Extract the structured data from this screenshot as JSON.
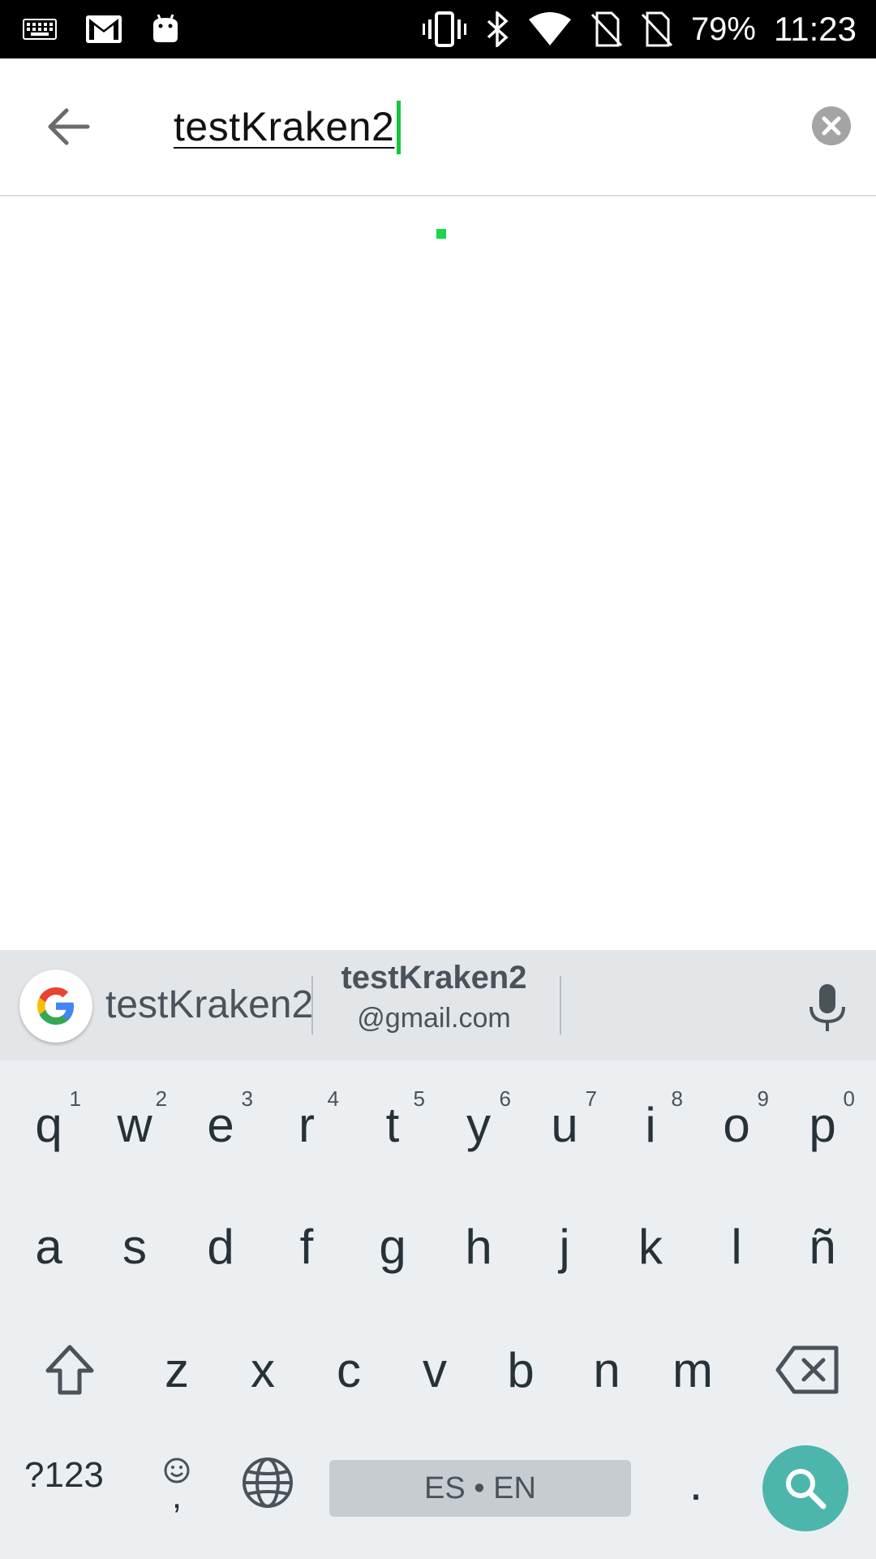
{
  "status_bar": {
    "icons_left": [
      "keyboard-icon",
      "gmail-icon",
      "android-icon"
    ],
    "icons_right": [
      "vibrate-icon",
      "bluetooth-icon",
      "wifi-icon",
      "no-sim-icon",
      "no-sim-icon"
    ],
    "battery": "79%",
    "time": "11:23"
  },
  "search": {
    "query": "testKraken2",
    "back_icon": "arrow-left-icon",
    "clear_icon": "clear-circle-icon"
  },
  "keyboard": {
    "suggestions": {
      "first": "testKraken2",
      "second_line1": "testKraken2",
      "second_line2": "@gmail.com"
    },
    "row1": [
      {
        "key": "q",
        "hint": "1"
      },
      {
        "key": "w",
        "hint": "2"
      },
      {
        "key": "e",
        "hint": "3"
      },
      {
        "key": "r",
        "hint": "4"
      },
      {
        "key": "t",
        "hint": "5"
      },
      {
        "key": "y",
        "hint": "6"
      },
      {
        "key": "u",
        "hint": "7"
      },
      {
        "key": "i",
        "hint": "8"
      },
      {
        "key": "o",
        "hint": "9"
      },
      {
        "key": "p",
        "hint": "0"
      }
    ],
    "row2": [
      "a",
      "s",
      "d",
      "f",
      "g",
      "h",
      "j",
      "k",
      "l",
      "ñ"
    ],
    "row3": [
      "z",
      "x",
      "c",
      "v",
      "b",
      "n",
      "m"
    ],
    "symbols_label": "?123",
    "comma_label": ",",
    "space_label": "ES • EN",
    "period_label": ".",
    "accent_color": "#4db6ac"
  }
}
